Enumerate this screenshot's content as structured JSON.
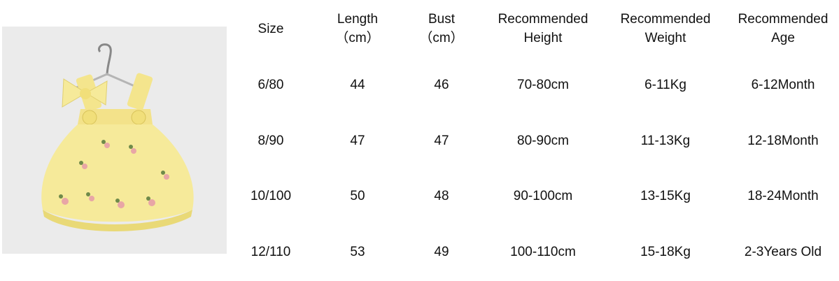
{
  "product_image": {
    "alt": "",
    "description_icon": "yellow-dress-on-hanger"
  },
  "size_table": {
    "headers": [
      {
        "line1": "Size",
        "line2": ""
      },
      {
        "line1": "Length",
        "line2": "（cm）"
      },
      {
        "line1": "Bust",
        "line2": "（cm）"
      },
      {
        "line1": "Recommended",
        "line2": "Height"
      },
      {
        "line1": "Recommended",
        "line2": "Weight"
      },
      {
        "line1": "Recommended",
        "line2": "Age"
      }
    ],
    "rows": [
      [
        "6/80",
        "44",
        "46",
        "70-80cm",
        "6-11Kg",
        "6-12Month"
      ],
      [
        "8/90",
        "47",
        "47",
        "80-90cm",
        "11-13Kg",
        "12-18Month"
      ],
      [
        "10/100",
        "50",
        "48",
        "90-100cm",
        "13-15Kg",
        "18-24Month"
      ],
      [
        "12/110",
        "53",
        "49",
        "100-110cm",
        "15-18Kg",
        "2-3Years Old"
      ]
    ]
  },
  "colors": {
    "dress": "#f6ea9a",
    "dress_shadow": "#e9d977",
    "background": "#ebebeb",
    "flower": "#e8a6a6",
    "leaf": "#6f8a4a"
  }
}
